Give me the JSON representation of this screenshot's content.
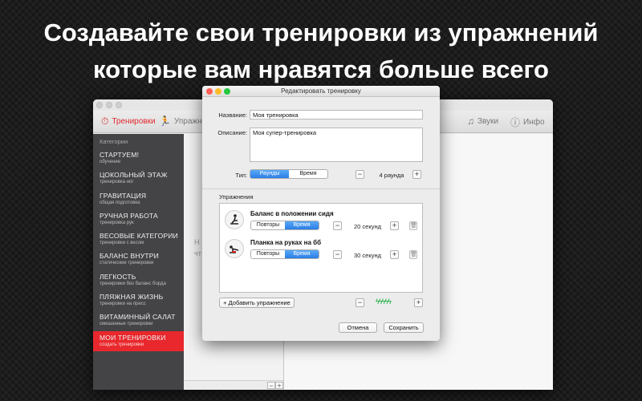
{
  "headline": {
    "line1": "Создавайте свои тренировки из упражнений",
    "line2": "которые вам нравятся больше всего"
  },
  "toolbar": {
    "workouts": "Тренировки",
    "exercises": "Упражнения",
    "sounds": "Звуки",
    "info": "Инфо"
  },
  "sidebar": {
    "header": "Категории",
    "items": [
      {
        "title": "СТАРТУЕМ!",
        "subtitle": "обучение"
      },
      {
        "title": "ЦОКОЛЬНЫЙ ЭТАЖ",
        "subtitle": "тренировка ног"
      },
      {
        "title": "ГРАВИТАЦИЯ",
        "subtitle": "общая подготовка"
      },
      {
        "title": "РУЧНАЯ РАБОТА",
        "subtitle": "тренировка рук"
      },
      {
        "title": "ВЕСОВЫЕ КАТЕГОРИИ",
        "subtitle": "тренировки с весом"
      },
      {
        "title": "БАЛАНС ВНУТРИ",
        "subtitle": "статические тренировки"
      },
      {
        "title": "ЛЕГКОСТЬ",
        "subtitle": "тренировки без баланс борда"
      },
      {
        "title": "ПЛЯЖНАЯ ЖИЗНЬ",
        "subtitle": "тренировки на пресс"
      },
      {
        "title": "ВИТАМИННЫЙ САЛАТ",
        "subtitle": "смешанные тренировки"
      },
      {
        "title": "МОИ ТРЕНИРОВКИ",
        "subtitle": "создать тренировки"
      }
    ],
    "active_index": 9
  },
  "middle": {
    "line1": "Н",
    "line2": "чт"
  },
  "dialog": {
    "title": "Редактировать тренировку",
    "name_label": "Название:",
    "name_value": "Моя тренировка",
    "description_label": "Описание:",
    "description_value": "Моя супер-тренировка",
    "type_label": "Тип:",
    "type_options": [
      "Раунды",
      "Время"
    ],
    "type_selected": "Раунды",
    "rounds_value": "4 раунда",
    "exercises_header": "Упражнения",
    "exercises": [
      {
        "name": "Баланс в положении сидя",
        "mode_options": [
          "Повторы",
          "Время"
        ],
        "mode_selected": "Время",
        "value": "20 секунд"
      },
      {
        "name": "Планка на руках на бб",
        "mode_options": [
          "Повторы",
          "Время"
        ],
        "mode_selected": "Время",
        "value": "30 секунд"
      }
    ],
    "add_exercise": "+ Добавить упражнение",
    "intensity": "ϟϟϟϟϟ",
    "cancel": "Отмена",
    "save": "Сохранить"
  },
  "colors": {
    "accent_red": "#e8282d",
    "segment_blue": "#2b7ee6",
    "intensity_green": "#2bb24c"
  }
}
